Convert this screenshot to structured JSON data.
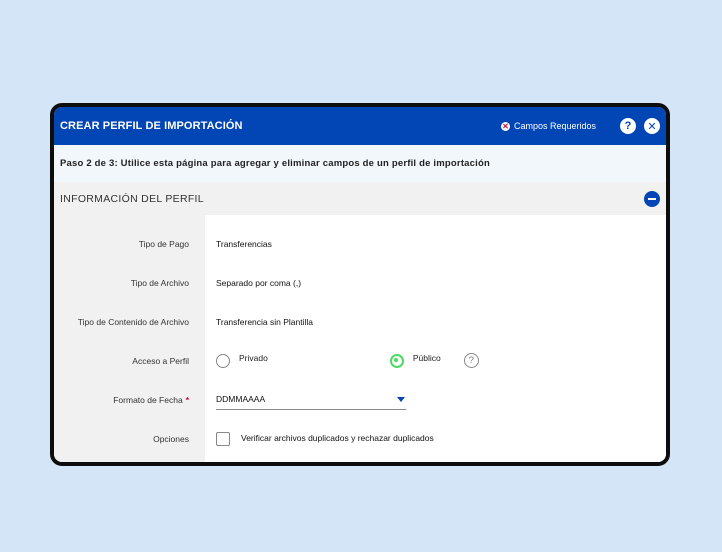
{
  "window": {
    "title": "CREAR PERFIL DE IMPORTACIÓN",
    "required_label": "Campos Requeridos",
    "help_symbol": "?",
    "close_symbol": "✕"
  },
  "step": "Paso 2 de 3:  Utilice esta página para agregar y eliminar campos de un perfil de importación",
  "section": {
    "title": "INFORMACIÓN DEL PERFIL"
  },
  "form": {
    "payment_type": {
      "label": "Tipo de Pago",
      "value": "Transferencias"
    },
    "file_type": {
      "label": "Tipo de Archivo",
      "value": "Separado por coma (,)"
    },
    "content_type": {
      "label": "Tipo de Contenido de Archivo",
      "value": "Transferencia sin Plantilla"
    },
    "access": {
      "label": "Acceso a Perfil",
      "options": [
        "Privado",
        "Público"
      ],
      "selected": "Público",
      "help_symbol": "?"
    },
    "date_format": {
      "label": "Formato de Fecha",
      "required_mark": "*",
      "value": "DDMMAAAA"
    },
    "options": {
      "label": "Opciones",
      "checkbox_label": "Verificar archivos duplicados y rechazar duplicados",
      "checked": false
    }
  },
  "colors": {
    "brand": "#0146b4",
    "required": "#d1002f",
    "selected_radio": "#4cd964",
    "background": "#d4e5f7"
  },
  "icons": [
    "required-icon",
    "help-icon",
    "close-icon",
    "collapse-icon",
    "caret-down-icon",
    "question-icon"
  ]
}
